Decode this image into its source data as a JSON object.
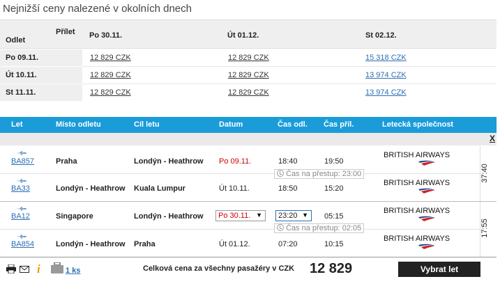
{
  "title": "Nejnižší ceny nalezené v okolních dnech",
  "matrix": {
    "corner_return": "Přílet",
    "corner_depart": "Odlet",
    "columns": [
      "Po 30.11.",
      "Út 01.12.",
      "St 02.12."
    ],
    "rows": [
      {
        "label": "Po 09.11.",
        "prices": [
          "12 829 CZK",
          "12 829 CZK",
          "15 318 CZK"
        ]
      },
      {
        "label": "Út 10.11.",
        "prices": [
          "12 829 CZK",
          "12 829 CZK",
          "13 974 CZK"
        ]
      },
      {
        "label": "St 11.11.",
        "prices": [
          "12 829 CZK",
          "12 829 CZK",
          "13 974 CZK"
        ]
      }
    ]
  },
  "flights_header": {
    "flight": "Let",
    "origin": "Místo odletu",
    "destination": "Cíl letu",
    "date": "Datum",
    "dep_time": "Čas odl.",
    "arr_time": "Čas příl.",
    "airline": "Letecká společnost"
  },
  "close_label": "X",
  "outbound": {
    "duration": "37:40",
    "transfer": "Čas na přestup: 23:00",
    "legs": [
      {
        "flight": "BA857",
        "origin": "Praha",
        "destination": "Londýn - Heathrow",
        "date": "Po 09.11.",
        "dep": "18:40",
        "arr": "19:50",
        "airline": "BRITISH AIRWAYS"
      },
      {
        "flight": "BA33",
        "origin": "Londýn - Heathrow",
        "destination": "Kuala Lumpur",
        "date": "Út 10.11.",
        "dep": "18:50",
        "arr": "15:20",
        "airline": "BRITISH AIRWAYS"
      }
    ]
  },
  "inbound": {
    "duration": "17:55",
    "transfer": "Čas na přestup: 02:05",
    "legs": [
      {
        "flight": "BA12",
        "origin": "Singapore",
        "destination": "Londýn - Heathrow",
        "date": "Po 30.11.",
        "dep": "23:20",
        "arr": "05:15",
        "airline": "BRITISH AIRWAYS"
      },
      {
        "flight": "BA854",
        "origin": "Londýn - Heathrow",
        "destination": "Praha",
        "date": "Út 01.12.",
        "dep": "07:20",
        "arr": "10:15",
        "airline": "BRITISH AIRWAYS"
      }
    ]
  },
  "footer": {
    "passengers": "1 ks",
    "total_label": "Celková cena za všechny pasažéry v CZK",
    "total_price": "12 829",
    "select_button": "Vybrat let"
  },
  "colors": {
    "header_blue": "#1a9cd9",
    "red": "#cc0000",
    "link_blue": "#2a6fb5"
  }
}
